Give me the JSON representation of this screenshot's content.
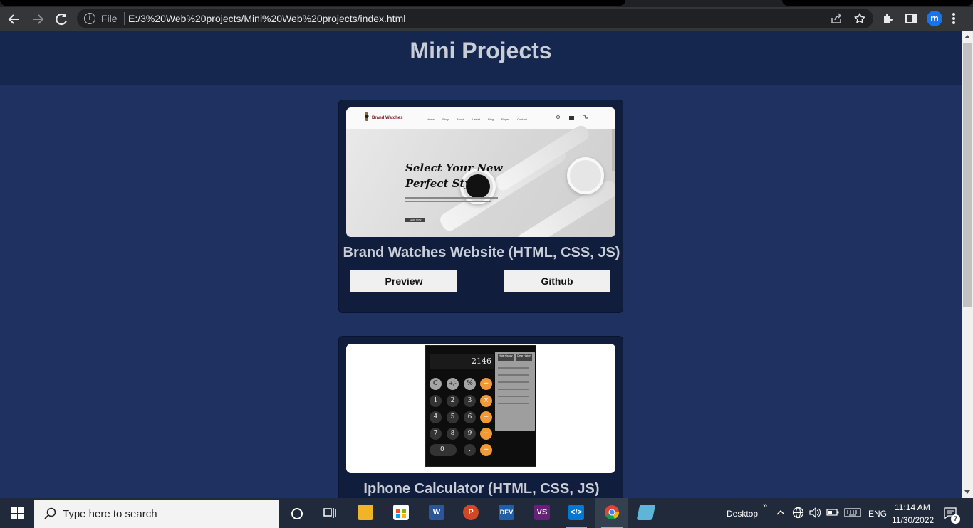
{
  "browser": {
    "file_label": "File",
    "url": "E:/3%20Web%20projects/Mini%20Web%20projects/index.html",
    "profile_initial": "m"
  },
  "page": {
    "title": "Mini Projects",
    "projects": [
      {
        "title": "Brand Watches Website (HTML, CSS, JS)",
        "preview_label": "Preview",
        "github_label": "Github",
        "thumbnail": {
          "brand": "Brand Watches",
          "menu": [
            "Home",
            "Shop",
            "About",
            "Latest",
            "Blog",
            "Pages",
            "Contact"
          ],
          "headline_line1": "Select Your New",
          "headline_line2": "Perfect Style",
          "button": "SHOP NOW"
        }
      },
      {
        "title": "Iphone Calculator (HTML, CSS, JS)",
        "thumbnail": {
          "display": "2146",
          "keys": [
            [
              "C",
              "+/-",
              "%",
              "÷"
            ],
            [
              "1",
              "2",
              "3",
              "×"
            ],
            [
              "4",
              "5",
              "6",
              "−"
            ],
            [
              "7",
              "8",
              "9",
              "+"
            ],
            [
              "0",
              ".",
              "="
            ]
          ],
          "history_buttons": [
            "Hide History",
            "Clear History"
          ]
        }
      }
    ]
  },
  "taskbar": {
    "search_placeholder": "Type here to search",
    "desktop_label": "Desktop",
    "language": "ENG",
    "time": "11:14 AM",
    "date": "11/30/2022",
    "notification_count": "7",
    "apps": [
      "task-view",
      "file-explorer",
      "microsoft-store",
      "word",
      "powerpoint",
      "dev-cpp",
      "visual-studio",
      "vs-code",
      "chrome",
      "notepad"
    ]
  }
}
